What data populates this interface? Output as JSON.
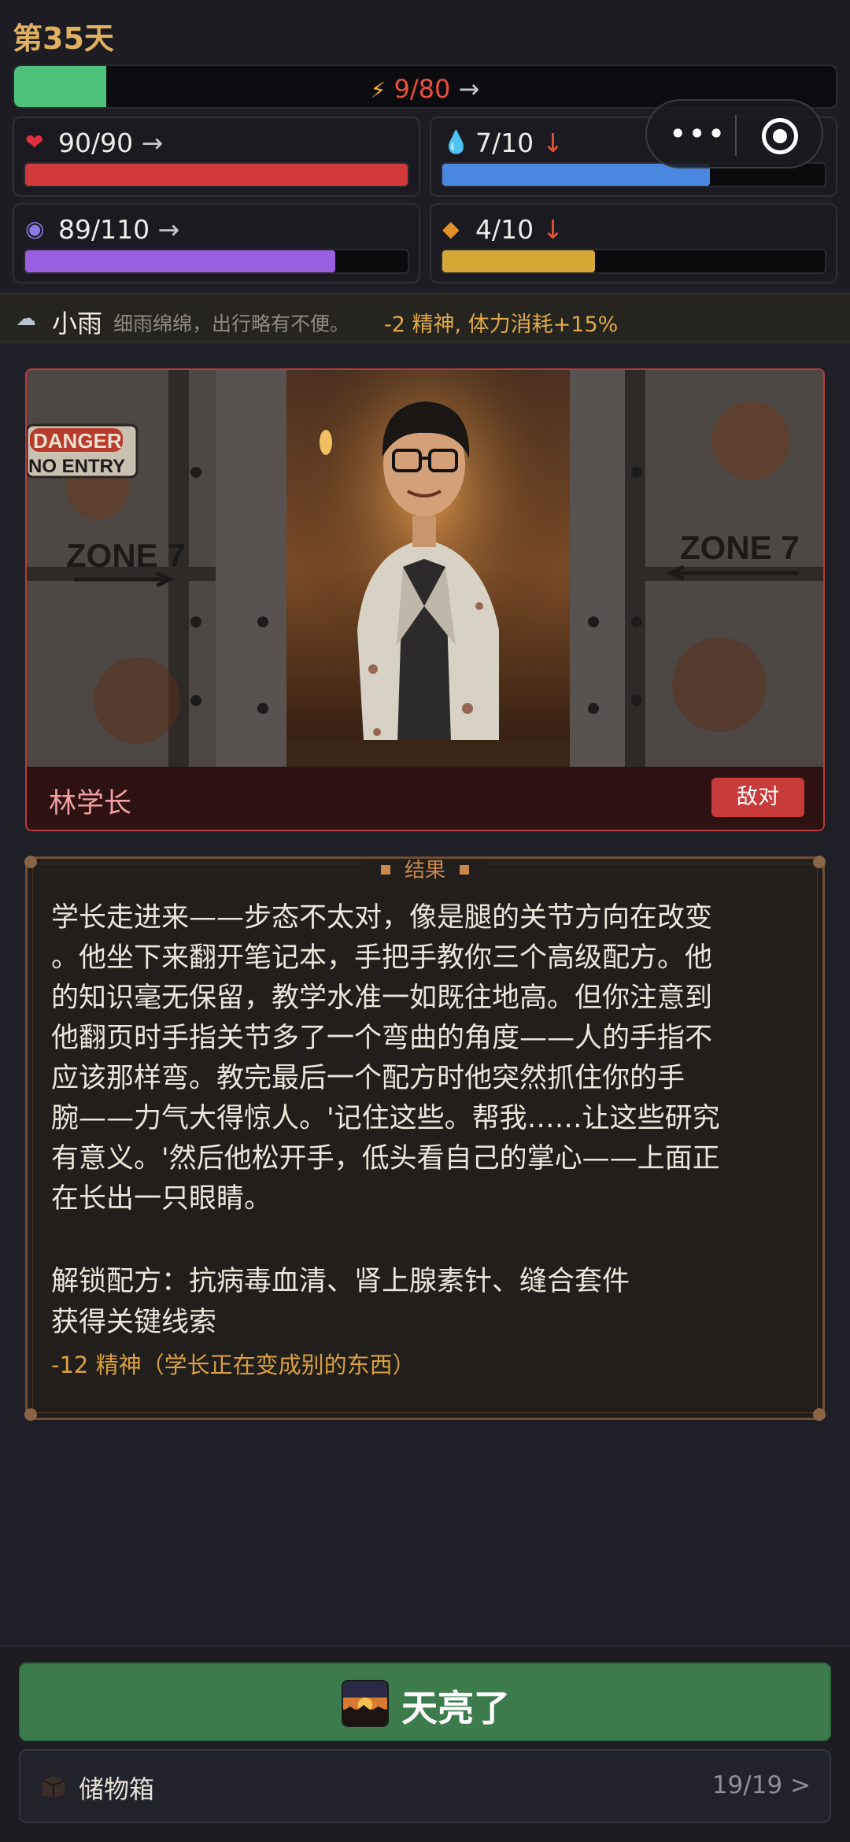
{
  "header": {
    "day": "第35天",
    "energy": {
      "value": "9/80",
      "trend": "→",
      "fill": 0.1125,
      "color": "#4cc27a"
    }
  },
  "stats": [
    {
      "name": "health",
      "icon": "heart-icon",
      "value": "90/90",
      "trend": "→",
      "fill": 1.0,
      "color": "#d03a3a"
    },
    {
      "name": "water",
      "icon": "water-drop-icon",
      "value": "7/10",
      "trend": "↓",
      "fill": 0.7,
      "color": "#4a88e0"
    },
    {
      "name": "sanity",
      "icon": "brain-icon",
      "value": "89/110",
      "trend": "→",
      "fill": 0.81,
      "color": "#9a5ee0"
    },
    {
      "name": "food",
      "icon": "food-icon",
      "value": "4/10",
      "trend": "↓",
      "fill": 0.4,
      "color": "#d4a834"
    }
  ],
  "weather": {
    "icon": "rain-cloud-icon",
    "name": "小雨",
    "description": "细雨绵绵，出行略有不便。",
    "effect": "-2 精神, 体力消耗+15%"
  },
  "encounter": {
    "name": "林学长",
    "status": "敌对",
    "sign_text_1": "DANGER",
    "sign_text_2": "NO ENTRY",
    "zone_left": "ZONE 7",
    "zone_right": "ZONE 7"
  },
  "result": {
    "title": "结果",
    "story": "学长走进来——步态不太对，像是腿的关节方向在改变\n。他坐下来翻开笔记本，手把手教你三个高级配方。他\n的知识毫无保留，教学水准一如既往地高。但你注意到\n他翻页时手指关节多了一个弯曲的角度——人的手指不\n应该那样弯。教完最后一个配方时他突然抓住你的手\n腕——力气大得惊人。'记住这些。帮我……让这些研究\n有意义。'然后他松开手，低头看自己的掌心——上面正\n在长出一只眼睛。",
    "unlock": "解锁配方：抗病毒血清、肾上腺素针、缝合套件",
    "clue": "获得关键线索",
    "penalty": "-12 精神（学长正在变成别的东西）"
  },
  "actions": {
    "dawn_label": "天亮了",
    "storage_label": "储物箱",
    "storage_count": "19/19 >"
  },
  "capsule": {
    "more_icon": "more-dots-icon",
    "target_icon": "target-icon"
  }
}
